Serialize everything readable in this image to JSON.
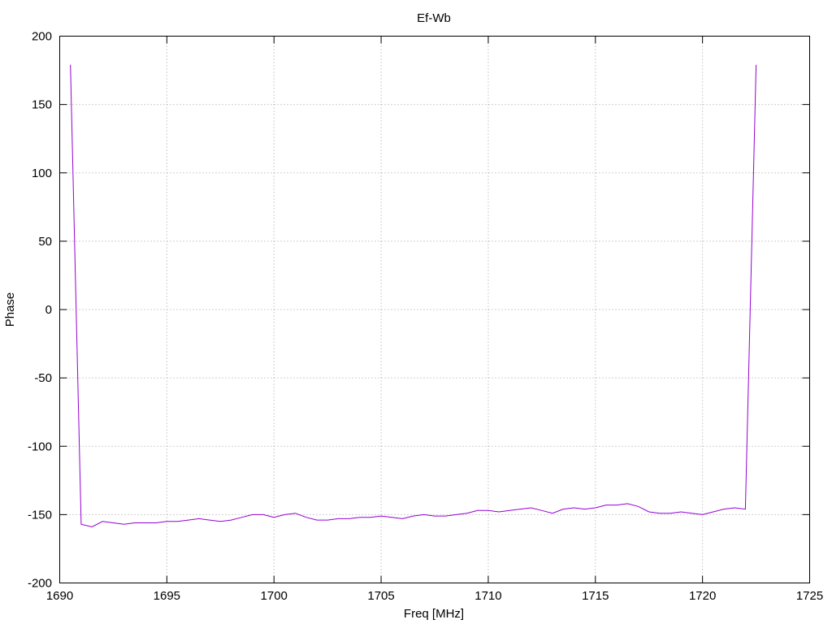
{
  "chart_data": {
    "type": "line",
    "title": "Ef-Wb",
    "xlabel": "Freq [MHz]",
    "ylabel": "Phase",
    "xlim": [
      1690,
      1725
    ],
    "ylim": [
      -200,
      200
    ],
    "xticks": [
      1690,
      1695,
      1700,
      1705,
      1710,
      1715,
      1720,
      1725
    ],
    "yticks": [
      -200,
      -150,
      -100,
      -50,
      0,
      50,
      100,
      150,
      200
    ],
    "grid": true,
    "series_color": "#9400d3",
    "series": [
      {
        "x": [
          1690.5,
          1691.0,
          1691.5,
          1692.0,
          1692.5,
          1693.0,
          1693.5,
          1694.0,
          1694.5,
          1695.0,
          1695.5,
          1696.0,
          1696.5,
          1697.0,
          1697.5,
          1698.0,
          1698.5,
          1699.0,
          1699.5,
          1700.0,
          1700.5,
          1701.0,
          1701.5,
          1702.0,
          1702.5,
          1703.0,
          1703.5,
          1704.0,
          1704.5,
          1705.0,
          1705.5,
          1706.0,
          1706.5,
          1707.0,
          1707.5,
          1708.0,
          1708.5,
          1709.0,
          1709.5,
          1710.0,
          1710.5,
          1711.0,
          1711.5,
          1712.0,
          1712.5,
          1713.0,
          1713.5,
          1714.0,
          1714.5,
          1715.0,
          1715.5,
          1716.0,
          1716.5,
          1717.0,
          1717.5,
          1718.0,
          1718.5,
          1719.0,
          1719.5,
          1720.0,
          1720.5,
          1721.0,
          1721.5,
          1722.0,
          1722.5
        ],
        "y": [
          179,
          -157,
          -159,
          -155,
          -156,
          -157,
          -156,
          -156,
          -156,
          -155,
          -155,
          -154,
          -153,
          -154,
          -155,
          -154,
          -152,
          -150,
          -150,
          -152,
          -150,
          -149,
          -152,
          -154,
          -154,
          -153,
          -153,
          -152,
          -152,
          -151,
          -152,
          -153,
          -151,
          -150,
          -151,
          -151,
          -150,
          -149,
          -147,
          -147,
          -148,
          -147,
          -146,
          -145,
          -147,
          -149,
          -146,
          -145,
          -146,
          -145,
          -143,
          -143,
          -142,
          -144,
          -148,
          -149,
          -149,
          -148,
          -149,
          -150,
          -148,
          -146,
          -145,
          -146,
          179
        ]
      }
    ]
  }
}
